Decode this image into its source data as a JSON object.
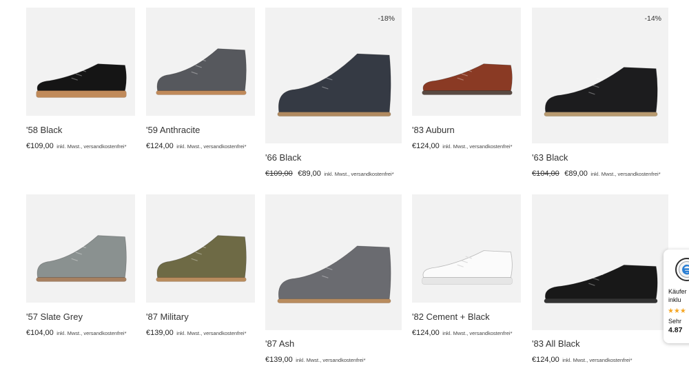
{
  "products": [
    {
      "name": "'58 Black",
      "price": "€109,00",
      "note": "inkl. Mwst., versandkostenfrei*",
      "sole": "#c08a5a",
      "upper": "#151515",
      "shape": "sneaker"
    },
    {
      "name": "'59 Anthracite",
      "price": "€124,00",
      "note": "inkl. Mwst., versandkostenfrei*",
      "sole": "#c08a5a",
      "upper": "#56585d",
      "shape": "chukka"
    },
    {
      "name": "'66 Black",
      "old_price": "€109,00",
      "price": "€89,00",
      "badge": "-18%",
      "note": "inkl. Mwst., versandkostenfrei*",
      "sole": "#b08a60",
      "upper": "#353a44",
      "shape": "high"
    },
    {
      "name": "'83 Auburn",
      "price": "€124,00",
      "note": "inkl. Mwst., versandkostenfrei*",
      "sole": "#5a4a42",
      "upper": "#8a3a24",
      "shape": "low"
    },
    {
      "name": "'63 Black",
      "old_price": "€104,00",
      "price": "€89,00",
      "badge": "-14%",
      "note": "inkl. Mwst., versandkostenfrei*",
      "sole": "#b89a70",
      "upper": "#1c1c1e",
      "shape": "mid"
    },
    {
      "name": "'57 Slate Grey",
      "price": "€104,00",
      "note": "inkl. Mwst., versandkostenfrei*",
      "sole": "#a78060",
      "upper": "#8a9190",
      "shape": "chukka"
    },
    {
      "name": "'87 Military",
      "price": "€139,00",
      "note": "inkl. Mwst., versandkostenfrei*",
      "sole": "#b98c5e",
      "upper": "#6e6a45",
      "shape": "chukka"
    },
    {
      "name": "'87 Ash",
      "price": "€139,00",
      "note": "inkl. Mwst., versandkostenfrei*",
      "sole": "#b98c5e",
      "upper": "#6a6b70",
      "shape": "chukka"
    },
    {
      "name": "'82 Cement + Black",
      "price": "€124,00",
      "note": "inkl. Mwst., versandkostenfrei*",
      "sole": "#e6e6e6",
      "upper": "#fbfbfb",
      "shape": "sneaker"
    },
    {
      "name": "'83 All Black",
      "price": "€124,00",
      "note": "inkl. Mwst., versandkostenfrei*",
      "sole": "#333333",
      "upper": "#181818",
      "shape": "low"
    }
  ],
  "trust_widget": {
    "line1": "Käufer",
    "line2": "inklu",
    "stars": "★★★",
    "rating_word": "Sehr",
    "score": "4.87"
  }
}
